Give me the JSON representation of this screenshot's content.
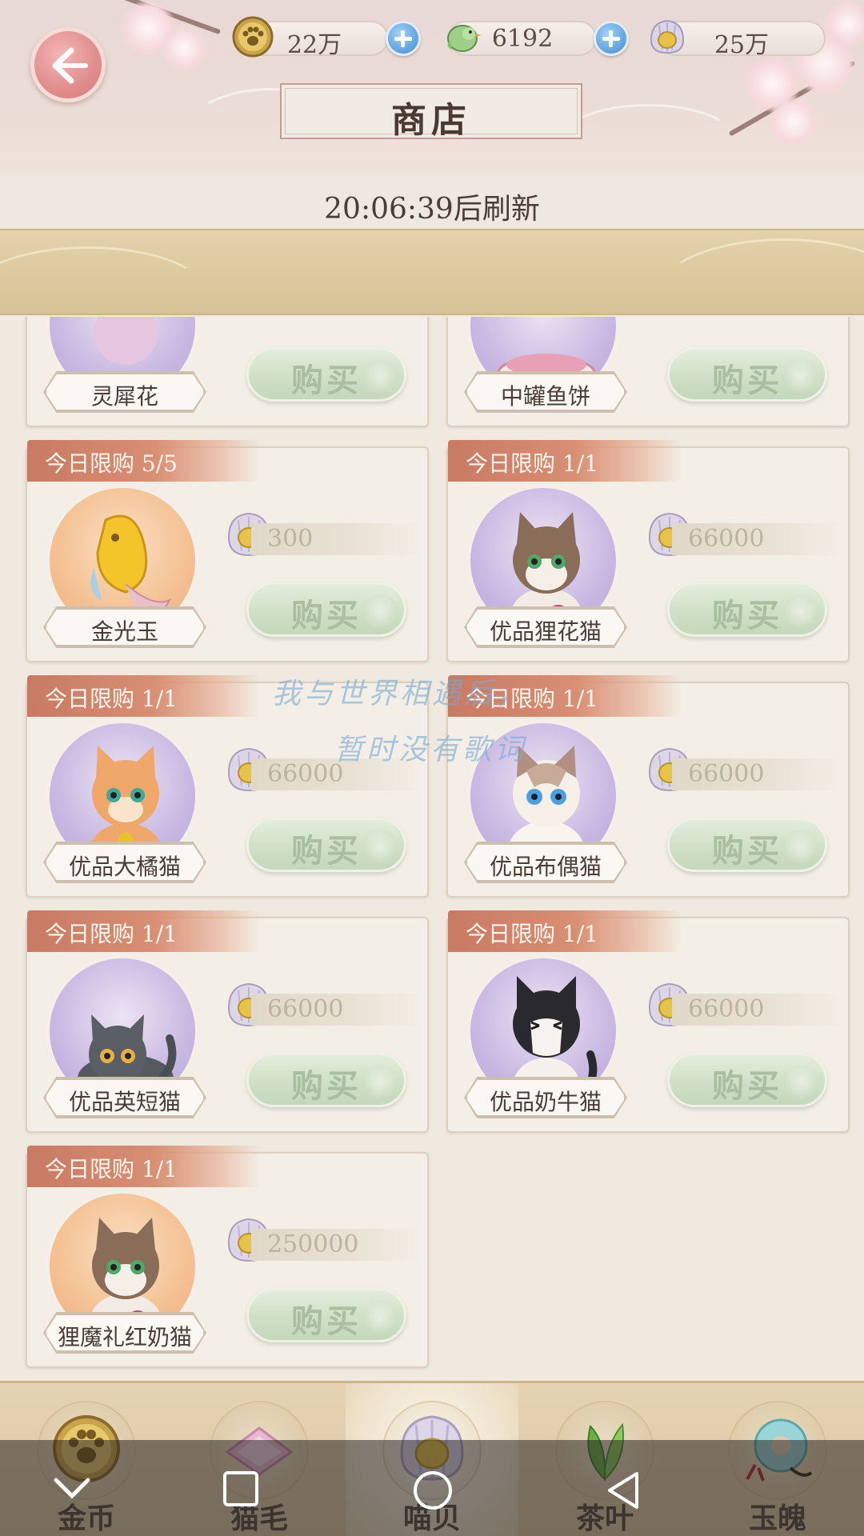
{
  "header": {
    "title": "商店",
    "refresh_text": "20:06:39后刷新",
    "currencies": [
      {
        "icon": "paw-coin-icon",
        "value": "22万",
        "has_plus": true
      },
      {
        "icon": "jade-bird-icon",
        "value": "6192",
        "has_plus": true
      },
      {
        "icon": "pearl-shell-icon",
        "value": "25万",
        "has_plus": false
      }
    ]
  },
  "items": [
    {
      "name": "灵犀花",
      "limit": "",
      "price": "",
      "buy_label": "购买",
      "bg": "purple"
    },
    {
      "name": "中罐鱼饼",
      "limit": "",
      "price": "",
      "buy_label": "购买",
      "bg": "purple"
    },
    {
      "name": "金光玉",
      "limit": "今日限购 5/5",
      "price": "300",
      "buy_label": "购买",
      "bg": "orange"
    },
    {
      "name": "优品狸花猫",
      "limit": "今日限购 1/1",
      "price": "66000",
      "buy_label": "购买",
      "bg": "purple"
    },
    {
      "name": "优品大橘猫",
      "limit": "今日限购 1/1",
      "price": "66000",
      "buy_label": "购买",
      "bg": "purple"
    },
    {
      "name": "优品布偶猫",
      "limit": "今日限购 1/1",
      "price": "66000",
      "buy_label": "购买",
      "bg": "purple"
    },
    {
      "name": "优品英短猫",
      "limit": "今日限购 1/1",
      "price": "66000",
      "buy_label": "购买",
      "bg": "purple"
    },
    {
      "name": "优品奶牛猫",
      "limit": "今日限购 1/1",
      "price": "66000",
      "buy_label": "购买",
      "bg": "purple"
    },
    {
      "name": "狸魔礼红奶猫",
      "limit": "今日限购 1/1",
      "price": "250000",
      "buy_label": "购买",
      "bg": "orange"
    }
  ],
  "overlay": {
    "lyric_line1": "我与世界相遇后，",
    "lyric_line2": "暂时没有歌词"
  },
  "tabs": [
    {
      "label": "金币",
      "icon": "paw-coin-icon",
      "active": false
    },
    {
      "label": "猫毛",
      "icon": "cat-fur-icon",
      "active": false
    },
    {
      "label": "喵贝",
      "icon": "pearl-shell-icon",
      "active": true
    },
    {
      "label": "茶叶",
      "icon": "tea-leaf-icon",
      "active": false
    },
    {
      "label": "玉魄",
      "icon": "jade-pendant-icon",
      "active": false
    }
  ],
  "colors": {
    "accent_tag": "#d98f74",
    "buy_button": "#cfe0c6",
    "background": "#efe9df"
  }
}
